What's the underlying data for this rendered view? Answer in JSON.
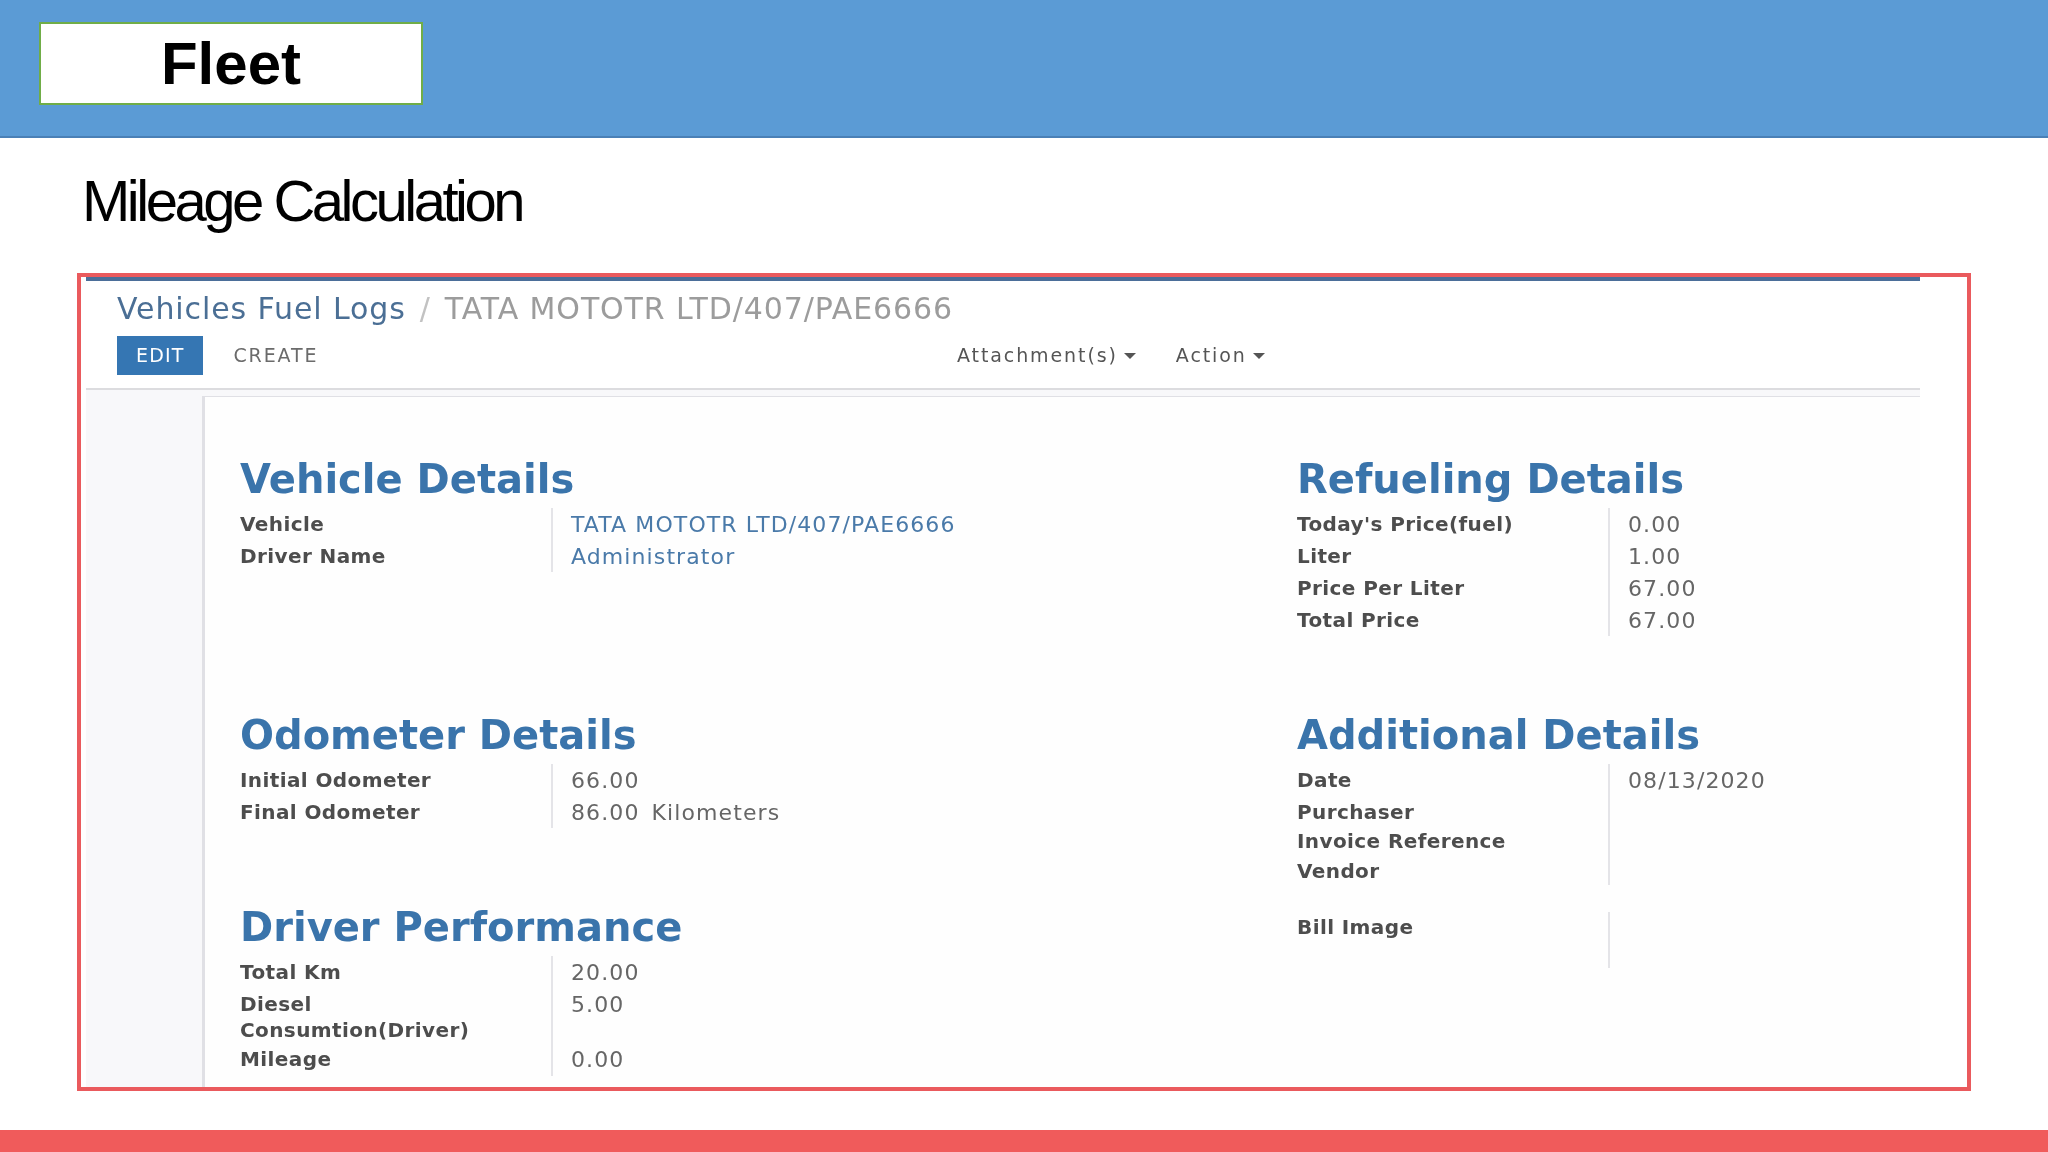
{
  "slide": {
    "section": "Fleet",
    "title": "Mileage Calculation"
  },
  "screenshot": {
    "breadcrumb": {
      "separator": "/",
      "items": [
        {
          "label": "Vehicles Fuel Logs",
          "kind": "link"
        },
        {
          "label": "TATA MOTOTR LTD/407/PAE6666",
          "kind": "current"
        }
      ]
    },
    "buttons": [
      {
        "label": "EDIT",
        "kind": "primary"
      },
      {
        "label": "CREATE",
        "kind": "secondary"
      }
    ],
    "menus": [
      {
        "label": "Attachment(s)"
      },
      {
        "label": "Action"
      }
    ],
    "form": {
      "columns": [
        {
          "sections": [
            {
              "title": "Vehicle Details",
              "groups": [
                {
                  "fields": [
                    {
                      "label": "Vehicle",
                      "kind": "link",
                      "value": "TATA MOTOTR LTD/407/PAE6666"
                    },
                    {
                      "label": "Driver Name",
                      "kind": "link",
                      "value": "Administrator"
                    }
                  ]
                }
              ]
            },
            {
              "title": "Odometer Details",
              "groups": [
                {
                  "fields": [
                    {
                      "label": "Initial Odometer",
                      "kind": "text",
                      "value": "66.00"
                    },
                    {
                      "label": "Final Odometer",
                      "kind": "text",
                      "value": "86.00",
                      "unit": "Kilometers"
                    }
                  ]
                }
              ]
            },
            {
              "title": "Driver Performance",
              "groups": [
                {
                  "fields": [
                    {
                      "label": "Total Km",
                      "kind": "text",
                      "value": "20.00"
                    },
                    {
                      "label": "Diesel Consumtion(Driver)",
                      "kind": "text",
                      "value": "5.00"
                    },
                    {
                      "label": "Mileage",
                      "kind": "text",
                      "value": "0.00"
                    }
                  ]
                }
              ]
            }
          ]
        },
        {
          "sections": [
            {
              "title": "Refueling Details",
              "groups": [
                {
                  "fields": [
                    {
                      "label": "Today's Price(fuel)",
                      "kind": "text",
                      "value": "0.00"
                    },
                    {
                      "label": "Liter",
                      "kind": "text",
                      "value": "1.00"
                    },
                    {
                      "label": "Price Per Liter",
                      "kind": "text",
                      "value": "67.00"
                    },
                    {
                      "label": "Total Price",
                      "kind": "text",
                      "value": "67.00"
                    }
                  ]
                }
              ]
            },
            {
              "title": "Additional Details",
              "groups": [
                {
                  "fields": [
                    {
                      "label": "Date",
                      "kind": "text",
                      "value": "08/13/2020"
                    },
                    {
                      "label": "Purchaser",
                      "kind": "text"
                    },
                    {
                      "label": "Invoice Reference",
                      "kind": "text"
                    },
                    {
                      "label": "Vendor",
                      "kind": "text"
                    }
                  ]
                },
                {
                  "fields": [
                    {
                      "label": "Bill Image",
                      "kind": "image"
                    }
                  ]
                }
              ]
            }
          ]
        }
      ]
    }
  }
}
